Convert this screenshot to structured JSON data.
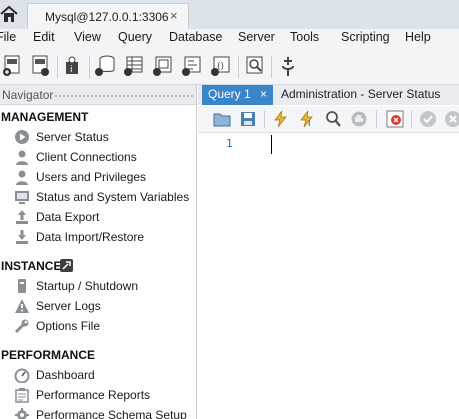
{
  "connection_tab": {
    "label": "Mysql@127.0.0.1:3306",
    "close": "×"
  },
  "menu": [
    "File",
    "Edit",
    "View",
    "Query",
    "Database",
    "Server",
    "Tools",
    "Scripting",
    "Help"
  ],
  "navigator": {
    "title": "Navigator",
    "sections": [
      {
        "title": "MANAGEMENT",
        "items": [
          {
            "label": "Server Status",
            "icon": "play-circle-icon"
          },
          {
            "label": "Client Connections",
            "icon": "user-icon"
          },
          {
            "label": "Users and Privileges",
            "icon": "user-icon"
          },
          {
            "label": "Status and System Variables",
            "icon": "monitor-icon"
          },
          {
            "label": "Data Export",
            "icon": "upload-icon"
          },
          {
            "label": "Data Import/Restore",
            "icon": "download-icon"
          }
        ]
      },
      {
        "title": "INSTANCE",
        "items": [
          {
            "label": "Startup / Shutdown",
            "icon": "power-icon"
          },
          {
            "label": "Server Logs",
            "icon": "warning-icon"
          },
          {
            "label": "Options File",
            "icon": "wrench-icon"
          }
        ]
      },
      {
        "title": "PERFORMANCE",
        "items": [
          {
            "label": "Dashboard",
            "icon": "dashboard-icon"
          },
          {
            "label": "Performance Reports",
            "icon": "reports-icon"
          },
          {
            "label": "Performance Schema Setup",
            "icon": "gear-icon"
          }
        ]
      }
    ]
  },
  "editor": {
    "tabs": [
      {
        "label": "Query 1",
        "active": true,
        "close": "×"
      },
      {
        "label": "Administration - Server Status",
        "active": false
      }
    ],
    "line_numbers": [
      "1"
    ]
  },
  "colors": {
    "accent": "#3a85c8",
    "tabstrip": "#dde3ea",
    "toolbar": "#f3f4f5"
  }
}
